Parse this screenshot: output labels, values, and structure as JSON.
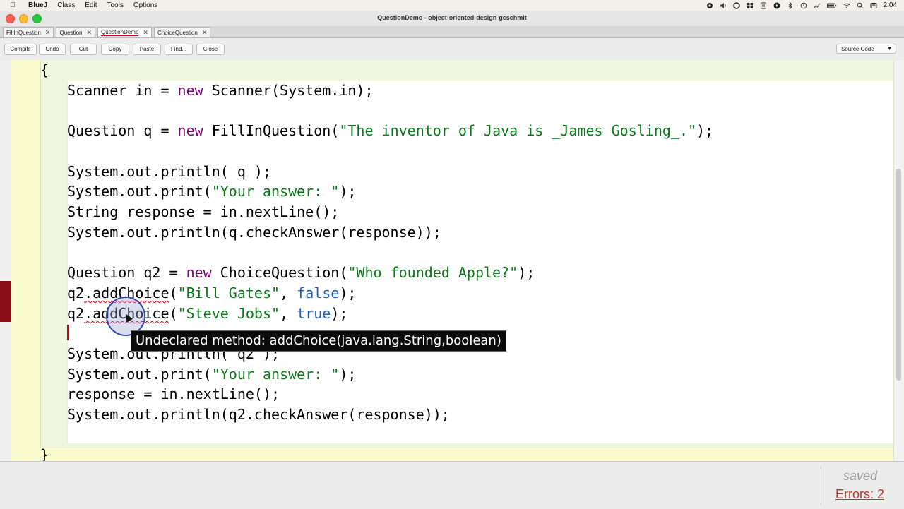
{
  "menubar": {
    "items": [
      "BlueJ",
      "Class",
      "Edit",
      "Tools",
      "Options"
    ],
    "clock": "2:04"
  },
  "window": {
    "title": "QuestionDemo - object-oriented-design-gcschmit"
  },
  "tabs": [
    {
      "label": "FillInQuestion",
      "active": false
    },
    {
      "label": "Question",
      "active": false
    },
    {
      "label": "QuestionDemo",
      "active": true
    },
    {
      "label": "ChoiceQuestion",
      "active": false
    }
  ],
  "toolbar": {
    "compile": "Compile",
    "undo": "Undo",
    "cut": "Cut",
    "copy": "Copy",
    "paste": "Paste",
    "find": "Find...",
    "close": "Close",
    "view": "Source Code"
  },
  "code": {
    "open_brace": "{",
    "close_brace": "}",
    "l1": {
      "a": "Scanner in = ",
      "kw": "new",
      "b": " Scanner(System.in);"
    },
    "l2": {
      "a": "Question q = ",
      "kw": "new",
      "b": " FillInQuestion(",
      "s": "\"The inventor of Java is _James Gosling_.\"",
      "c": ");"
    },
    "l3": "System.out.println( q );",
    "l4": {
      "a": "System.out.print(",
      "s": "\"Your answer: \"",
      "c": ");"
    },
    "l5": "String response = in.nextLine();",
    "l6": "System.out.println(q.checkAnswer(response));",
    "l7": {
      "a": "Question q2 = ",
      "kw": "new",
      "b": " ChoiceQuestion(",
      "s": "\"Who founded Apple?\"",
      "c": ");"
    },
    "l8": {
      "pre": "q2",
      "err": ".addChoice",
      "a": "(",
      "s": "\"Bill Gates\"",
      "b": ", ",
      "lit": "false",
      "c": ");"
    },
    "l9": {
      "pre": "q2",
      "err": ".addChoice",
      "a": "(",
      "s": "\"Steve Jobs\"",
      "b": ", ",
      "lit": "true",
      "c": ");"
    },
    "l10": {
      "a": "System.out.println( q2 );"
    },
    "l11": {
      "a": "System.out.print(",
      "s": "\"Your answer: \"",
      "c": ");"
    },
    "l12": "response = in.nextLine();",
    "l13": "System.out.println(q2.checkAnswer(response));"
  },
  "tooltip": "Undeclared method: addChoice(java.lang.String,boolean)",
  "status": {
    "saved": "saved",
    "errors": "Errors: 2"
  },
  "colors": {
    "keyword": "#7a0874",
    "string": "#0b7a1a",
    "literal": "#1f5fb8",
    "error": "#d0021b"
  }
}
